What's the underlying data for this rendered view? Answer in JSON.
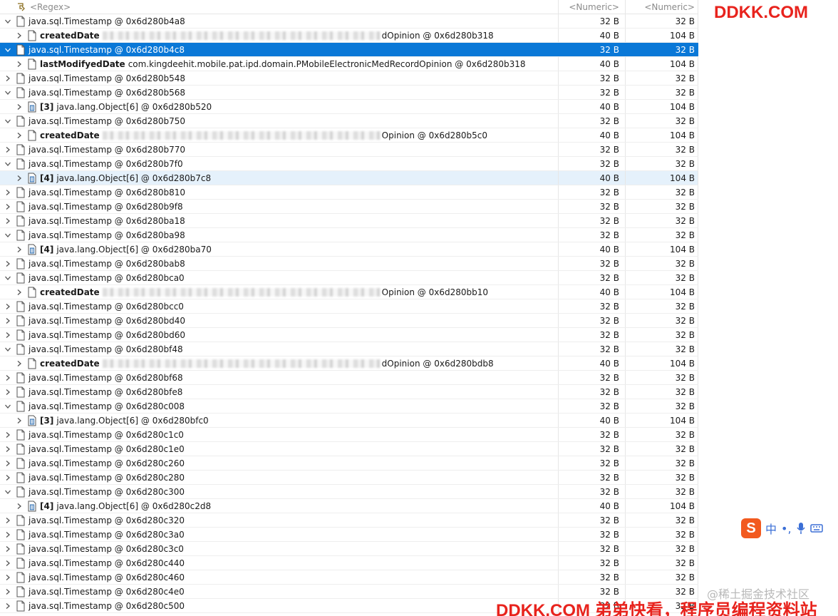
{
  "header": {
    "regex": "<Regex>",
    "col2": "<Numeric>",
    "col3": "<Numeric>"
  },
  "rows": [
    {
      "lvl": 0,
      "exp": "v",
      "icon": "file",
      "name": "",
      "text": "java.sql.Timestamp @ 0x6d280b4a8",
      "a": "32 B",
      "b": "32 B"
    },
    {
      "lvl": 1,
      "exp": ">",
      "icon": "file",
      "name": "createdDate",
      "blur": true,
      "text": "dOpinion @ 0x6d280b318",
      "a": "40 B",
      "b": "104 B"
    },
    {
      "lvl": 0,
      "exp": "v",
      "icon": "file",
      "name": "",
      "text": "java.sql.Timestamp @ 0x6d280b4c8",
      "a": "32 B",
      "b": "32 B",
      "state": "selected"
    },
    {
      "lvl": 1,
      "exp": ">",
      "icon": "file",
      "name": "lastModifyedDate",
      "text": "com.kingdeehit.mobile.pat.ipd.domain.PMobileElectronicMedRecordOpinion @ 0x6d280b318",
      "a": "40 B",
      "b": "104 B"
    },
    {
      "lvl": 0,
      "exp": ">",
      "icon": "file",
      "name": "",
      "text": "java.sql.Timestamp @ 0x6d280b548",
      "a": "32 B",
      "b": "32 B"
    },
    {
      "lvl": 0,
      "exp": "v",
      "icon": "file",
      "name": "",
      "text": "java.sql.Timestamp @ 0x6d280b568",
      "a": "32 B",
      "b": "32 B"
    },
    {
      "lvl": 1,
      "exp": ">",
      "icon": "array",
      "name": "[3]",
      "text": "java.lang.Object[6] @ 0x6d280b520",
      "a": "40 B",
      "b": "104 B"
    },
    {
      "lvl": 0,
      "exp": "v",
      "icon": "file",
      "name": "",
      "text": "java.sql.Timestamp @ 0x6d280b750",
      "a": "32 B",
      "b": "32 B"
    },
    {
      "lvl": 1,
      "exp": ">",
      "icon": "file",
      "name": "createdDate",
      "blur": true,
      "text": "Opinion @ 0x6d280b5c0",
      "a": "40 B",
      "b": "104 B"
    },
    {
      "lvl": 0,
      "exp": ">",
      "icon": "file",
      "name": "",
      "text": "java.sql.Timestamp @ 0x6d280b770",
      "a": "32 B",
      "b": "32 B"
    },
    {
      "lvl": 0,
      "exp": "v",
      "icon": "file",
      "name": "",
      "text": "java.sql.Timestamp @ 0x6d280b7f0",
      "a": "32 B",
      "b": "32 B"
    },
    {
      "lvl": 1,
      "exp": ">",
      "icon": "array",
      "name": "[4]",
      "text": "java.lang.Object[6] @ 0x6d280b7c8",
      "a": "40 B",
      "b": "104 B",
      "state": "hover"
    },
    {
      "lvl": 0,
      "exp": ">",
      "icon": "file",
      "name": "",
      "text": "java.sql.Timestamp @ 0x6d280b810",
      "a": "32 B",
      "b": "32 B"
    },
    {
      "lvl": 0,
      "exp": ">",
      "icon": "file",
      "name": "",
      "text": "java.sql.Timestamp @ 0x6d280b9f8",
      "a": "32 B",
      "b": "32 B"
    },
    {
      "lvl": 0,
      "exp": ">",
      "icon": "file",
      "name": "",
      "text": "java.sql.Timestamp @ 0x6d280ba18",
      "a": "32 B",
      "b": "32 B"
    },
    {
      "lvl": 0,
      "exp": "v",
      "icon": "file",
      "name": "",
      "text": "java.sql.Timestamp @ 0x6d280ba98",
      "a": "32 B",
      "b": "32 B"
    },
    {
      "lvl": 1,
      "exp": ">",
      "icon": "array",
      "name": "[4]",
      "text": "java.lang.Object[6] @ 0x6d280ba70",
      "a": "40 B",
      "b": "104 B"
    },
    {
      "lvl": 0,
      "exp": ">",
      "icon": "file",
      "name": "",
      "text": "java.sql.Timestamp @ 0x6d280bab8",
      "a": "32 B",
      "b": "32 B"
    },
    {
      "lvl": 0,
      "exp": "v",
      "icon": "file",
      "name": "",
      "text": "java.sql.Timestamp @ 0x6d280bca0",
      "a": "32 B",
      "b": "32 B"
    },
    {
      "lvl": 1,
      "exp": ">",
      "icon": "file",
      "name": "createdDate",
      "blur": true,
      "text": "Opinion @ 0x6d280bb10",
      "a": "40 B",
      "b": "104 B"
    },
    {
      "lvl": 0,
      "exp": ">",
      "icon": "file",
      "name": "",
      "text": "java.sql.Timestamp @ 0x6d280bcc0",
      "a": "32 B",
      "b": "32 B"
    },
    {
      "lvl": 0,
      "exp": ">",
      "icon": "file",
      "name": "",
      "text": "java.sql.Timestamp @ 0x6d280bd40",
      "a": "32 B",
      "b": "32 B"
    },
    {
      "lvl": 0,
      "exp": ">",
      "icon": "file",
      "name": "",
      "text": "java.sql.Timestamp @ 0x6d280bd60",
      "a": "32 B",
      "b": "32 B"
    },
    {
      "lvl": 0,
      "exp": "v",
      "icon": "file",
      "name": "",
      "text": "java.sql.Timestamp @ 0x6d280bf48",
      "a": "32 B",
      "b": "32 B"
    },
    {
      "lvl": 1,
      "exp": ">",
      "icon": "file",
      "name": "createdDate",
      "blur": true,
      "text": "dOpinion @ 0x6d280bdb8",
      "a": "40 B",
      "b": "104 B"
    },
    {
      "lvl": 0,
      "exp": ">",
      "icon": "file",
      "name": "",
      "text": "java.sql.Timestamp @ 0x6d280bf68",
      "a": "32 B",
      "b": "32 B"
    },
    {
      "lvl": 0,
      "exp": ">",
      "icon": "file",
      "name": "",
      "text": "java.sql.Timestamp @ 0x6d280bfe8",
      "a": "32 B",
      "b": "32 B"
    },
    {
      "lvl": 0,
      "exp": "v",
      "icon": "file",
      "name": "",
      "text": "java.sql.Timestamp @ 0x6d280c008",
      "a": "32 B",
      "b": "32 B"
    },
    {
      "lvl": 1,
      "exp": ">",
      "icon": "array",
      "name": "[3]",
      "text": "java.lang.Object[6] @ 0x6d280bfc0",
      "a": "40 B",
      "b": "104 B"
    },
    {
      "lvl": 0,
      "exp": ">",
      "icon": "file",
      "name": "",
      "text": "java.sql.Timestamp @ 0x6d280c1c0",
      "a": "32 B",
      "b": "32 B"
    },
    {
      "lvl": 0,
      "exp": ">",
      "icon": "file",
      "name": "",
      "text": "java.sql.Timestamp @ 0x6d280c1e0",
      "a": "32 B",
      "b": "32 B"
    },
    {
      "lvl": 0,
      "exp": ">",
      "icon": "file",
      "name": "",
      "text": "java.sql.Timestamp @ 0x6d280c260",
      "a": "32 B",
      "b": "32 B"
    },
    {
      "lvl": 0,
      "exp": ">",
      "icon": "file",
      "name": "",
      "text": "java.sql.Timestamp @ 0x6d280c280",
      "a": "32 B",
      "b": "32 B"
    },
    {
      "lvl": 0,
      "exp": "v",
      "icon": "file",
      "name": "",
      "text": "java.sql.Timestamp @ 0x6d280c300",
      "a": "32 B",
      "b": "32 B"
    },
    {
      "lvl": 1,
      "exp": ">",
      "icon": "array",
      "name": "[4]",
      "text": "java.lang.Object[6] @ 0x6d280c2d8",
      "a": "40 B",
      "b": "104 B"
    },
    {
      "lvl": 0,
      "exp": ">",
      "icon": "file",
      "name": "",
      "text": "java.sql.Timestamp @ 0x6d280c320",
      "a": "32 B",
      "b": "32 B"
    },
    {
      "lvl": 0,
      "exp": ">",
      "icon": "file",
      "name": "",
      "text": "java.sql.Timestamp @ 0x6d280c3a0",
      "a": "32 B",
      "b": "32 B"
    },
    {
      "lvl": 0,
      "exp": ">",
      "icon": "file",
      "name": "",
      "text": "java.sql.Timestamp @ 0x6d280c3c0",
      "a": "32 B",
      "b": "32 B"
    },
    {
      "lvl": 0,
      "exp": ">",
      "icon": "file",
      "name": "",
      "text": "java.sql.Timestamp @ 0x6d280c440",
      "a": "32 B",
      "b": "32 B"
    },
    {
      "lvl": 0,
      "exp": ">",
      "icon": "file",
      "name": "",
      "text": "java.sql.Timestamp @ 0x6d280c460",
      "a": "32 B",
      "b": "32 B"
    },
    {
      "lvl": 0,
      "exp": ">",
      "icon": "file",
      "name": "",
      "text": "java.sql.Timestamp @ 0x6d280c4e0",
      "a": "32 B",
      "b": "32 B"
    },
    {
      "lvl": 0,
      "exp": ">",
      "icon": "file",
      "name": "",
      "text": "java.sql.Timestamp @ 0x6d280c500",
      "a": "32 B",
      "b": "32 B"
    }
  ],
  "overlay": {
    "watermark_top": "DDKK.COM",
    "watermark_bottom": "DDKK.COM 弟弟快看，程序员编程资料站",
    "watermark_juejin": "@稀土掘金技术社区",
    "ime_logo": "S",
    "ime_lang": "中",
    "ime_punct": "•,"
  },
  "colors": {
    "selection": "#0a78d7",
    "hover": "#e5f1fb",
    "watermark": "#e8231d"
  }
}
